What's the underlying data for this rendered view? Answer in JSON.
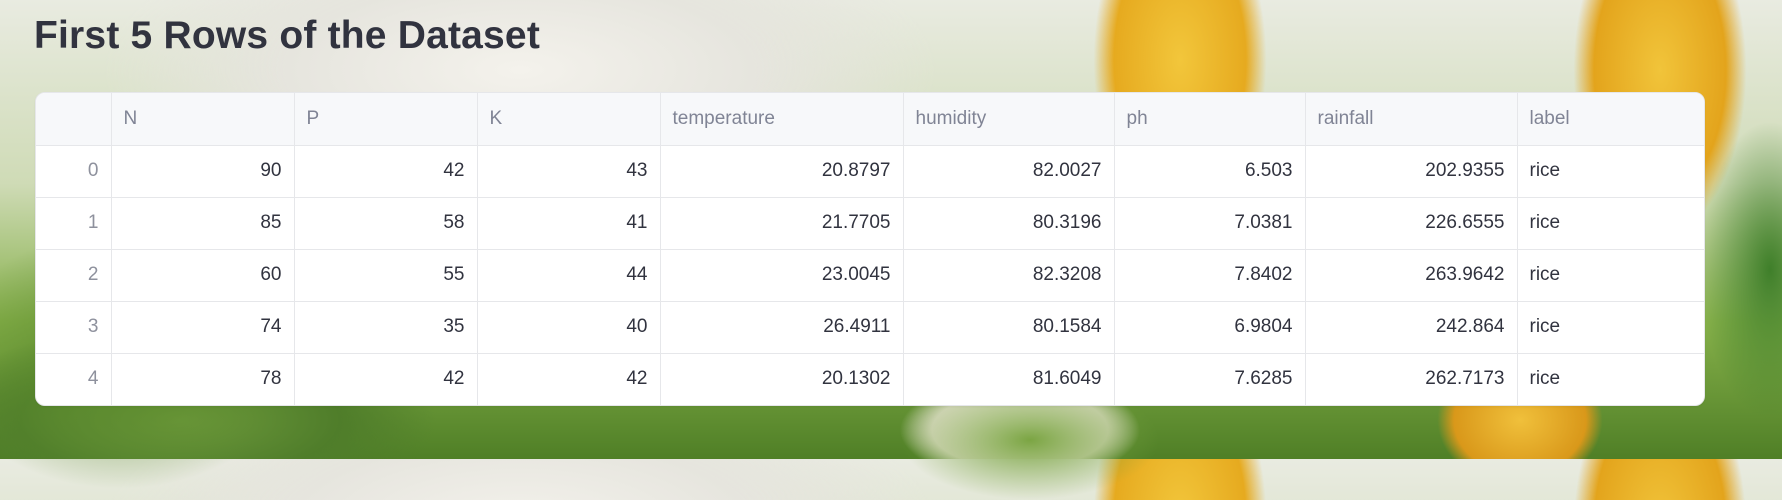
{
  "page": {
    "title": "First 5 Rows of the Dataset"
  },
  "table": {
    "columns": [
      "",
      "N",
      "P",
      "K",
      "temperature",
      "humidity",
      "ph",
      "rainfall",
      "label"
    ],
    "rows": [
      [
        "0",
        "90",
        "42",
        "43",
        "20.8797",
        "82.0027",
        "6.503",
        "202.9355",
        "rice"
      ],
      [
        "1",
        "85",
        "58",
        "41",
        "21.7705",
        "80.3196",
        "7.0381",
        "226.6555",
        "rice"
      ],
      [
        "2",
        "60",
        "55",
        "44",
        "23.0045",
        "82.3208",
        "7.8402",
        "263.9642",
        "rice"
      ],
      [
        "3",
        "74",
        "35",
        "40",
        "26.4911",
        "80.1584",
        "6.9804",
        "242.864",
        "rice"
      ],
      [
        "4",
        "78",
        "42",
        "42",
        "20.1302",
        "81.6049",
        "7.6285",
        "262.7173",
        "rice"
      ]
    ]
  },
  "colors": {
    "title_text": "#31333f",
    "header_bg": "#f7f8fa",
    "header_text": "#808495",
    "border": "#e6e7ea",
    "index_text": "#8e919d"
  }
}
